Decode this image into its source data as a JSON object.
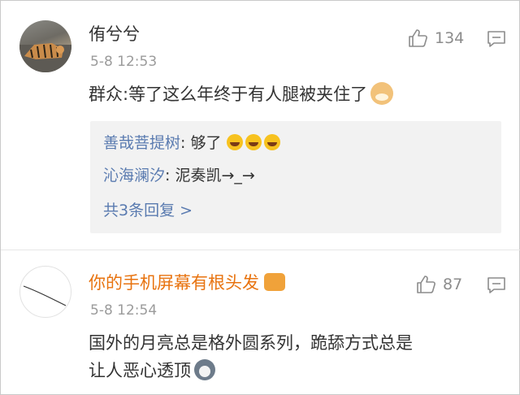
{
  "comments": [
    {
      "username": "侑兮兮",
      "time": "5-8 12:53",
      "likes": "134",
      "text": "群众:等了这么年终于有人腿被夹住了",
      "avatar_icon": "tiger-photo-avatar",
      "emoji_icon": "doge-emoji-icon",
      "replies": [
        {
          "name": "善哉菩提树",
          "sep": ": ",
          "text": "够了",
          "emoji_count": 3,
          "emoji_icon": "laughing-emoji-icon"
        },
        {
          "name": "沁海澜汐",
          "sep": ": ",
          "text": "泥奏凯→_→"
        }
      ],
      "more_replies": "共3条回复 >"
    },
    {
      "username": "你的手机屏幕有根头发",
      "time": "5-8 12:54",
      "likes": "87",
      "text_line1": "国外的月亮总是格外圆系列，跪舔方式总是",
      "text_line2": "让人恶心透顶",
      "avatar_icon": "hair-line-avatar",
      "badge_icon": "crown-badge-icon",
      "emoji_icon": "husky-emoji-icon"
    }
  ],
  "colors": {
    "link_blue": "#5a7bb0",
    "vip_orange": "#e8730f",
    "reply_bg": "#f2f2f2",
    "text_gray": "#9b9b9b"
  }
}
